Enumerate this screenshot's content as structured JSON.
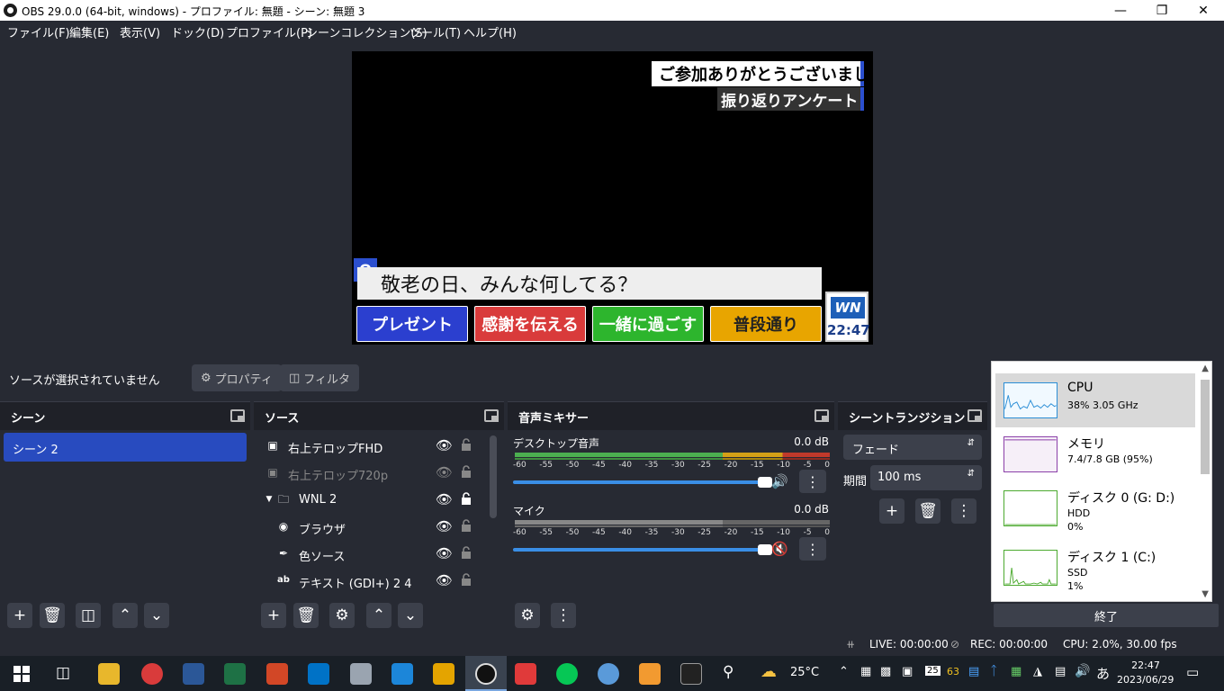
{
  "window": {
    "title": "OBS 29.0.0 (64-bit, windows) - プロファイル: 無題 - シーン: 無題 3"
  },
  "menu": [
    "ファイル(F)",
    "編集(E)",
    "表示(V)",
    "ドック(D)",
    "プロファイル(P)",
    "シーンコレクション(S)",
    "ツール(T)",
    "ヘルプ(H)"
  ],
  "preview": {
    "telop_top1": "ご参加ありがとうございました",
    "telop_top2": "振り返りアンケート",
    "q_mark": "Q",
    "question": "敬老の日、みんな何してる？",
    "answers": [
      "プレゼント",
      "感謝を伝える",
      "一緒に過ごす",
      "普段通り"
    ],
    "answer_colors": [
      "#2b3fcf",
      "#d93b3b",
      "#2db52d",
      "#e8a500"
    ],
    "logo": "WN",
    "clock": "22:47"
  },
  "controls": {
    "no_source": "ソースが選択されていません",
    "properties": "プロパティ",
    "filters": "フィルタ"
  },
  "docks": {
    "scenes": {
      "title": "シーン",
      "items": [
        "シーン 2"
      ]
    },
    "sources": {
      "title": "ソース",
      "items": [
        {
          "label": "右上テロップFHD"
        },
        {
          "label": "右上テロップ720p"
        },
        {
          "label": "WNL 2"
        },
        {
          "label": "ブラウザ"
        },
        {
          "label": "色ソース"
        },
        {
          "label": "テキスト (GDI+) 2 4"
        }
      ]
    },
    "mixer": {
      "title": "音声ミキサー",
      "channels": [
        {
          "name": "デスクトップ音声",
          "db": "0.0 dB"
        },
        {
          "name": "マイク",
          "db": "0.0 dB"
        }
      ],
      "scale": [
        "-60",
        "-55",
        "-50",
        "-45",
        "-40",
        "-35",
        "-30",
        "-25",
        "-20",
        "-15",
        "-10",
        "-5",
        "0"
      ]
    },
    "transitions": {
      "title": "シーントランジション",
      "transition": "フェード",
      "duration_label": "期間",
      "duration": "100 ms"
    }
  },
  "perf": {
    "cpu": {
      "name": "CPU",
      "sub": "38%  3.05 GHz"
    },
    "memory": {
      "name": "メモリ",
      "sub": "7.4/7.8 GB (95%)"
    },
    "disk0": {
      "name": "ディスク 0 (G: D:)",
      "sub1": "HDD",
      "sub2": "0%"
    },
    "disk1": {
      "name": "ディスク 1 (C:)",
      "sub1": "SSD",
      "sub2": "1%"
    },
    "end_label": "終了"
  },
  "status": {
    "live": "LIVE: 00:00:00",
    "rec": "REC: 00:00:00",
    "cpu": "CPU: 2.0%, 30.00 fps"
  },
  "taskbar": {
    "weather": "25°C",
    "time": "22:47",
    "date": "2023/06/29",
    "ime": "あ",
    "tray_num1": "25",
    "tray_num2": "63"
  }
}
